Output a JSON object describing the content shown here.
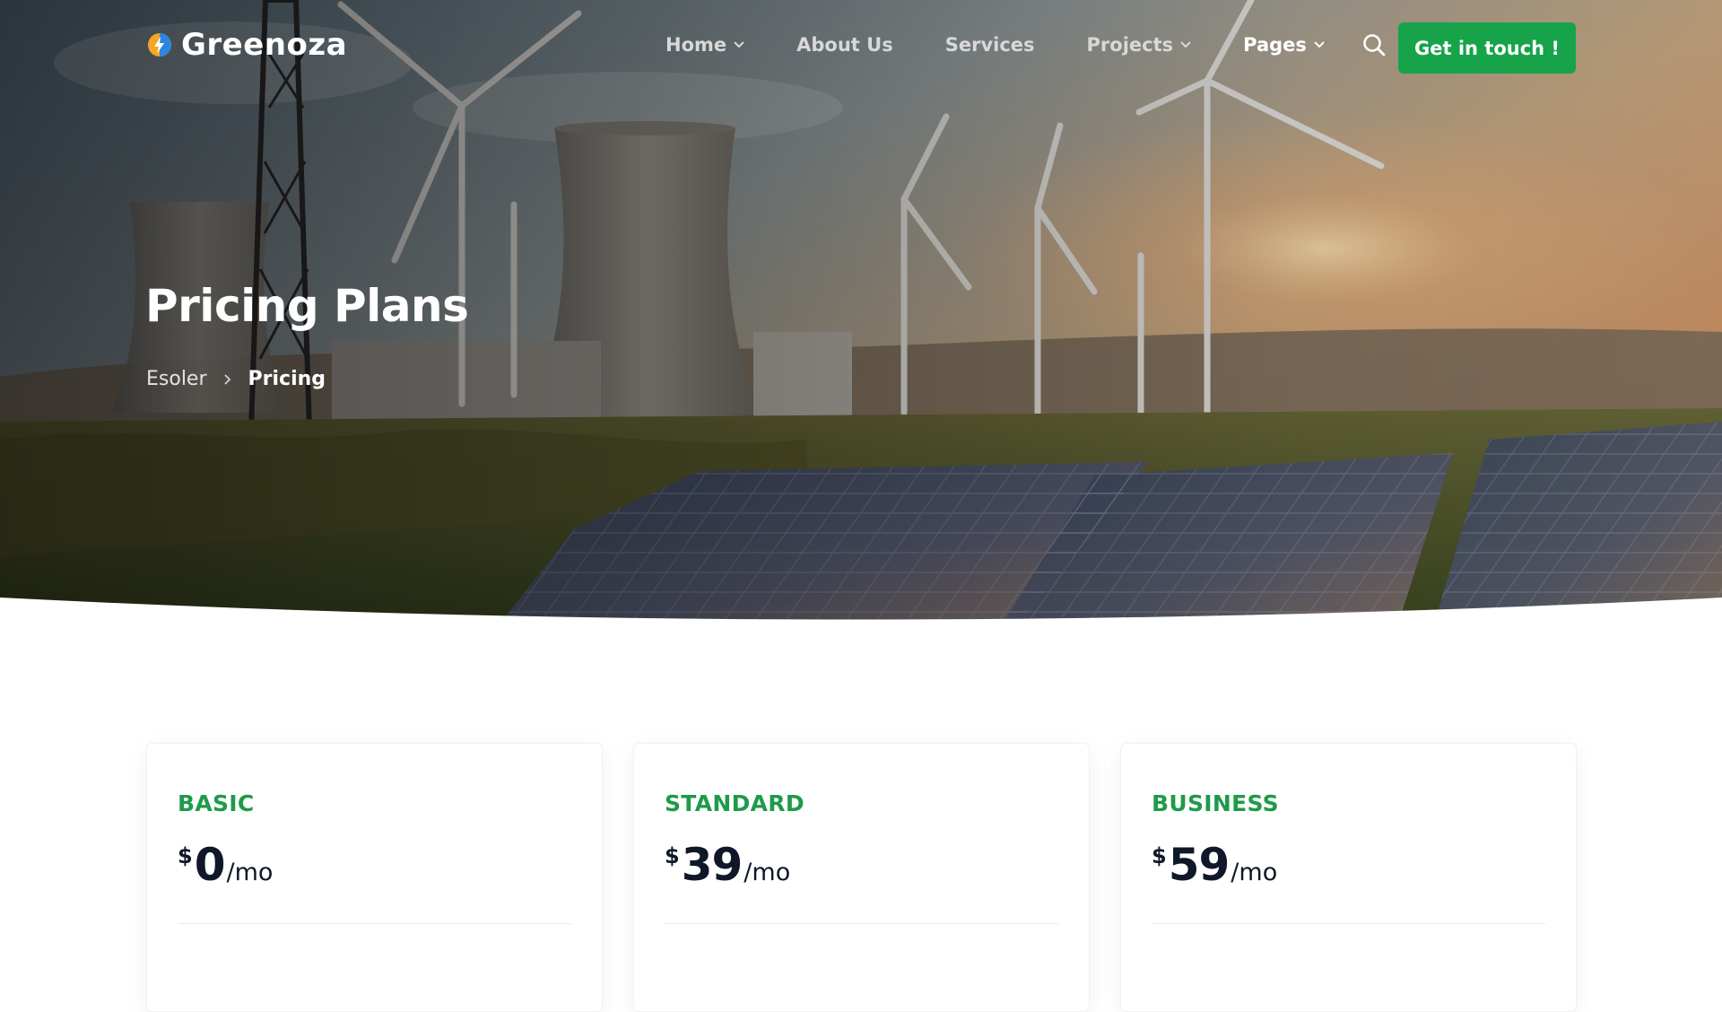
{
  "brand": {
    "name": "Greenoza"
  },
  "nav": {
    "items": [
      {
        "label": "Home",
        "has_dropdown": true,
        "active": false
      },
      {
        "label": "About Us",
        "has_dropdown": false,
        "active": false
      },
      {
        "label": "Services",
        "has_dropdown": false,
        "active": false
      },
      {
        "label": "Projects",
        "has_dropdown": true,
        "active": false
      },
      {
        "label": "Pages",
        "has_dropdown": true,
        "active": true
      }
    ],
    "search_icon": "search-icon",
    "cta_label": "Get in touch !"
  },
  "hero": {
    "title": "Pricing Plans",
    "breadcrumb": {
      "home": "Esoler",
      "separator_icon": "chevron-right-icon",
      "current": "Pricing"
    }
  },
  "pricing": {
    "plans": [
      {
        "name": "BASIC",
        "currency": "$",
        "amount": "0",
        "period": "/mo"
      },
      {
        "name": "STANDARD",
        "currency": "$",
        "amount": "39",
        "period": "/mo"
      },
      {
        "name": "BUSINESS",
        "currency": "$",
        "amount": "59",
        "period": "/mo"
      }
    ]
  },
  "colors": {
    "accent": "#16a34a",
    "plan_name": "#1f9a4a",
    "price_text": "#0f1728"
  }
}
